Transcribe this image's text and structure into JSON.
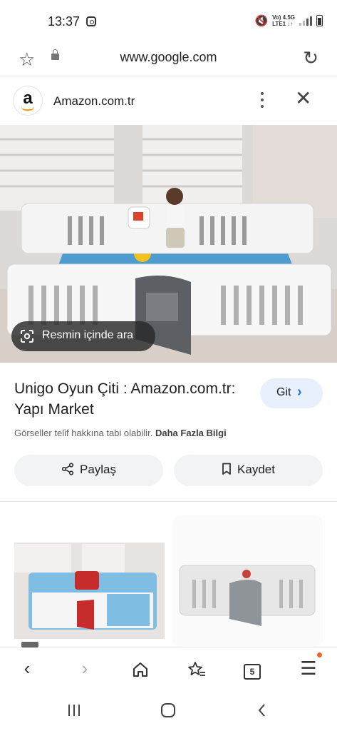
{
  "status_bar": {
    "time": "13:37",
    "network_line1": "Vo) 4.5G",
    "network_line2": "LTE1 ↓↑"
  },
  "browser": {
    "url": "www.google.com"
  },
  "sheet": {
    "site_name": "Amazon.com.tr",
    "lens_label": "Resmin içinde ara",
    "title": "Unigo Oyun Çiti : Amazon.com.tr: Yapı Market",
    "visit_label": "Git",
    "copyright_text": "Görseller telif hakkına tabi olabilir.",
    "more_info_link": "Daha Fazla Bilgi",
    "share_label": "Paylaş",
    "save_label": "Kaydet"
  },
  "bottom_bar": {
    "tab_count": "5"
  },
  "colors": {
    "accent": "#1a73e8",
    "visit_bg": "#e8f0fe",
    "chip_bg": "#f1f3f4",
    "amazon_orange": "#ff9900",
    "notification_dot": "#f0642a"
  },
  "icons": [
    "star-icon",
    "lock-icon",
    "reload-icon",
    "more-vert-icon",
    "close-icon",
    "lens-icon",
    "chevron-right-icon",
    "share-icon",
    "bookmark-icon",
    "back-icon",
    "forward-icon",
    "home-icon",
    "bookmarks-icon",
    "tabs-icon",
    "menu-icon"
  ]
}
